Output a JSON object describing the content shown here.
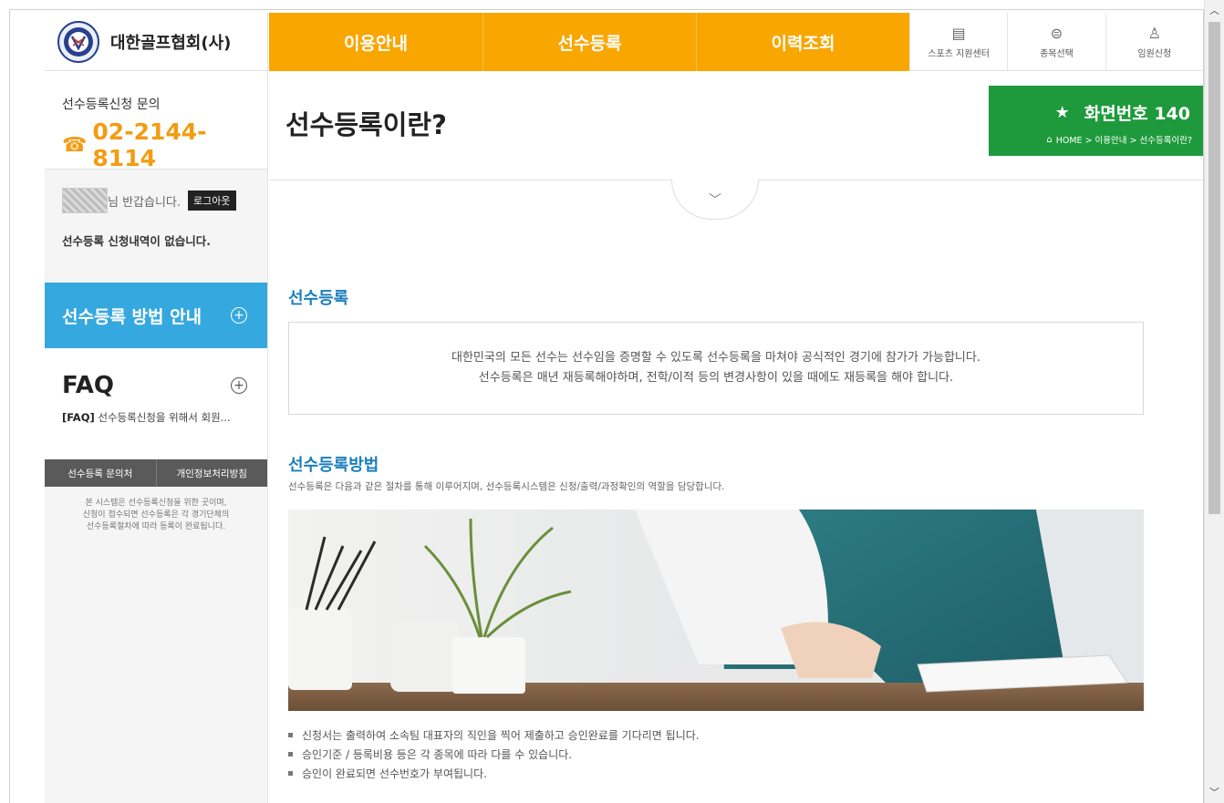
{
  "header": {
    "org_name": "대한골프협회(사)",
    "nav_tabs": [
      "이용안내",
      "선수등록",
      "이력조회"
    ],
    "utility_links": [
      {
        "label": "스포츠 지원센터",
        "icon": "document-icon"
      },
      {
        "label": "종목선택",
        "icon": "ball-icon"
      },
      {
        "label": "임원신청",
        "icon": "user-icon"
      }
    ]
  },
  "sidebar": {
    "contact_label": "선수등록신청 문의",
    "contact_phone": "02-2144-8114",
    "greeting": "님 반갑습니다.",
    "logout_label": "로그아웃",
    "user_status": "선수등록 신청내역이 없습니다.",
    "guide_label": "선수등록 방법 안내",
    "faq_title": "FAQ",
    "faq_prefix": "[FAQ]",
    "faq_item": "선수등록신청을 위해서 회원...",
    "footer_tabs": [
      "선수등록 문의처",
      "개인정보처리방침"
    ],
    "footer_note": [
      "본 시스템은 선수등록신청을 위한 곳이며,",
      "신청이 접수되면 선수등록은 각 경기단체의",
      "선수등록절차에 따라 등록이 완료됩니다."
    ]
  },
  "page": {
    "title": "선수등록이란?",
    "screen_number": "화면번호 140",
    "breadcrumb": "HOME > 이용안내 > 선수등록이란?"
  },
  "content": {
    "section1_title": "선수등록",
    "intro_lines": [
      "대한민국의 모든 선수는 선수임을 증명할 수 있도록 선수등록을 마쳐야 공식적인 경기에 참가가 가능합니다.",
      "선수등록은 매년 재등록해야하며, 전학/이적 등의 변경사항이 있을 때에도 재등록을 해야 합니다."
    ],
    "section2_title": "선수등록방법",
    "method_desc": "선수등록은 다음과 같은 절차를 통해 이루어지며, 선수등록시스템은 신청/출력/과정확인의 역할을 담당합니다.",
    "bullets": [
      "신청서는 출력하여 소속팀 대표자의 직인을 찍어 제출하고 승인완료를 기다리면 됩니다.",
      "승인기준 / 등록비용 등은 각 종목에 따라 다를 수 있습니다.",
      "승인이 완료되면 선수번호가 부여됩니다."
    ]
  },
  "colors": {
    "nav_orange": "#f9a600",
    "guide_blue": "#35a8e0",
    "badge_green": "#1e9a3c",
    "phone_orange": "#f39c12",
    "section_blue": "#1a7fbd"
  }
}
